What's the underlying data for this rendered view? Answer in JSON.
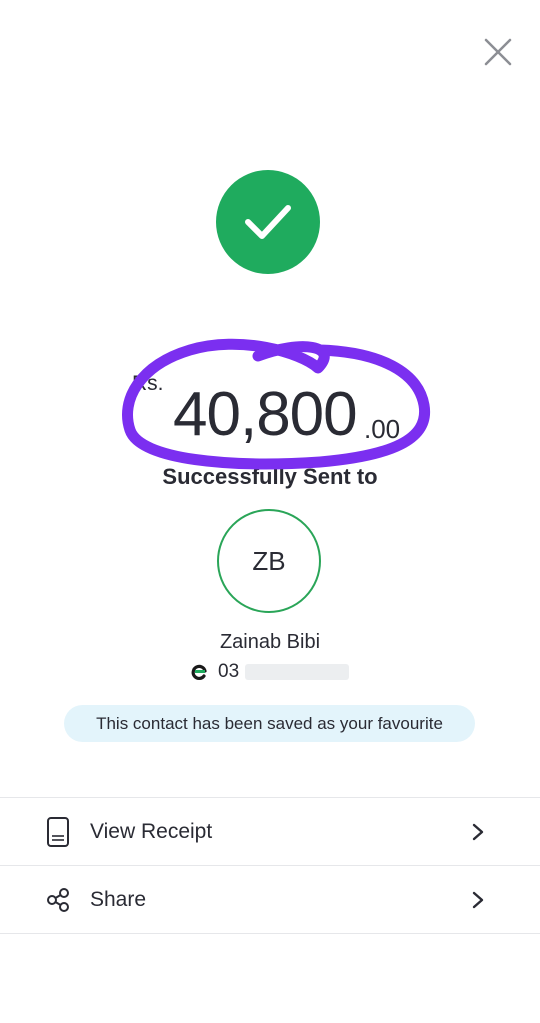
{
  "header": {
    "close_icon": "close-icon"
  },
  "status": {
    "icon": "checkmark-icon",
    "color": "#1fab5e"
  },
  "transaction": {
    "currency": "Rs.",
    "amount": "40,800",
    "decimals": ".00",
    "status_text": "Successfully Sent to"
  },
  "recipient": {
    "initials": "ZB",
    "name": "Zainab Bibi",
    "number_visible": "03",
    "provider_icon": "easypaisa-icon"
  },
  "favourite_banner": {
    "text": "This contact has been saved as your favourite"
  },
  "actions": [
    {
      "label": "View Receipt",
      "icon": "receipt-icon"
    },
    {
      "label": "Share",
      "icon": "share-icon"
    }
  ],
  "colors": {
    "accent_green": "#1fab5e",
    "banner_bg": "#e3f4fb",
    "annotation_purple": "#7b2ff0"
  }
}
